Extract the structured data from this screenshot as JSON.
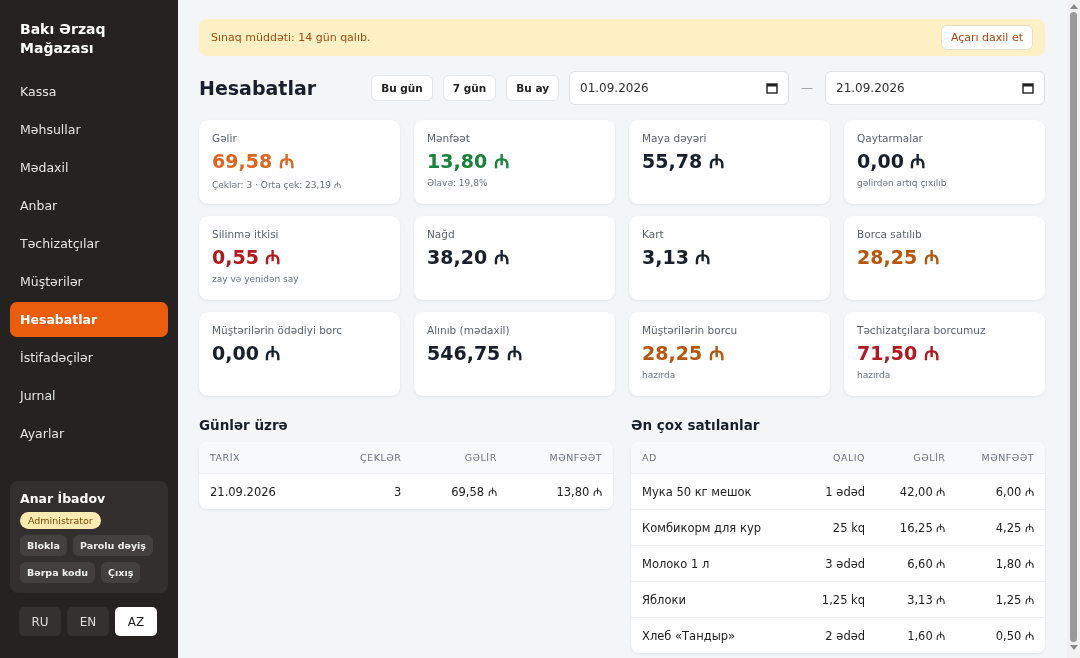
{
  "sidebar": {
    "brand": "Bakı Ərzaq Mağazası",
    "items": [
      {
        "label": "Kassa",
        "selected": false
      },
      {
        "label": "Məhsullar",
        "selected": false
      },
      {
        "label": "Mədaxil",
        "selected": false
      },
      {
        "label": "Anbar",
        "selected": false
      },
      {
        "label": "Təchizatçılar",
        "selected": false
      },
      {
        "label": "Müştərilər",
        "selected": false
      },
      {
        "label": "Hesabatlar",
        "selected": true
      },
      {
        "label": "İstifadəçilər",
        "selected": false
      },
      {
        "label": "Jurnal",
        "selected": false
      },
      {
        "label": "Ayarlar",
        "selected": false
      }
    ],
    "user": {
      "name": "Anar İbadov",
      "role": "Administrator",
      "actions": [
        "Blokla",
        "Parolu dəyiş",
        "Bərpa kodu",
        "Çıxış"
      ]
    },
    "languages": [
      {
        "label": "RU",
        "selected": false
      },
      {
        "label": "EN",
        "selected": false
      },
      {
        "label": "AZ",
        "selected": true
      }
    ]
  },
  "banner": {
    "text": "Sınaq müddəti: 14 gün qalıb.",
    "button": "Açarı daxil et"
  },
  "title": "Hesabatlar",
  "ranges": [
    "Bu gün",
    "7 gün",
    "Bu ay"
  ],
  "date_from": "01.09.2026",
  "date_sep": "—",
  "date_to": "21.09.2026",
  "stats": [
    {
      "label": "Gəlir",
      "value": "69,58 ₼",
      "color": "#e0641b",
      "note": "Çeklər: 3 · Orta çek: 23,19 ₼"
    },
    {
      "label": "Mənfəət",
      "value": "13,80 ₼",
      "color": "#16843a",
      "note": "Əlavə: 19,8%"
    },
    {
      "label": "Maya dəyəri",
      "value": "55,78 ₼",
      "color": "#18202e"
    },
    {
      "label": "Qaytarmalar",
      "value": "0,00 ₼",
      "color": "#18202e",
      "note": "gəlirdən artıq çıxılıb"
    },
    {
      "label": "Silinmə itkisi",
      "value": "0,55 ₼",
      "color": "#b3191f",
      "note": "zay və yenidən say"
    },
    {
      "label": "Nağd",
      "value": "38,20 ₼",
      "color": "#18202e"
    },
    {
      "label": "Kart",
      "value": "3,13 ₼",
      "color": "#18202e"
    },
    {
      "label": "Borca satılıb",
      "value": "28,25 ₼",
      "color": "#b8560e"
    },
    {
      "label": "Müştərilərin ödədiyi borc",
      "value": "0,00 ₼",
      "color": "#18202e"
    },
    {
      "label": "Alınıb (mədaxil)",
      "value": "546,75 ₼",
      "color": "#18202e"
    },
    {
      "label": "Müştərilərin borcu",
      "value": "28,25 ₼",
      "color": "#b8560e",
      "note": "hazırda"
    },
    {
      "label": "Təchizatçılara borcumuz",
      "value": "71,50 ₼",
      "color": "#b3191f",
      "note": "hazırda"
    }
  ],
  "by_day": {
    "title": "Günlər üzrə",
    "columns": [
      "TARİX",
      "ÇEKLƏR",
      "GƏLİR",
      "MƏNFƏƏT"
    ],
    "rows": [
      [
        "21.09.2026",
        "3",
        "69,58 ₼",
        "13,80 ₼"
      ]
    ]
  },
  "top_sold": {
    "title": "Ən çox satılanlar",
    "columns": [
      "AD",
      "QALIQ",
      "GƏLİR",
      "MƏNFƏƏT"
    ],
    "rows": [
      [
        "Мука 50 кг мешок",
        "1 ədəd",
        "42,00 ₼",
        "6,00 ₼"
      ],
      [
        "Комбикорм для кур",
        "25 kq",
        "16,25 ₼",
        "4,25 ₼"
      ],
      [
        "Молоко 1 л",
        "3 ədəd",
        "6,60 ₼",
        "1,80 ₼"
      ],
      [
        "Яблоки",
        "1,25 kq",
        "3,13 ₼",
        "1,25 ₼"
      ],
      [
        "Хлеб «Тандыр»",
        "2 ədəd",
        "1,60 ₼",
        "0,50 ₼"
      ]
    ]
  }
}
